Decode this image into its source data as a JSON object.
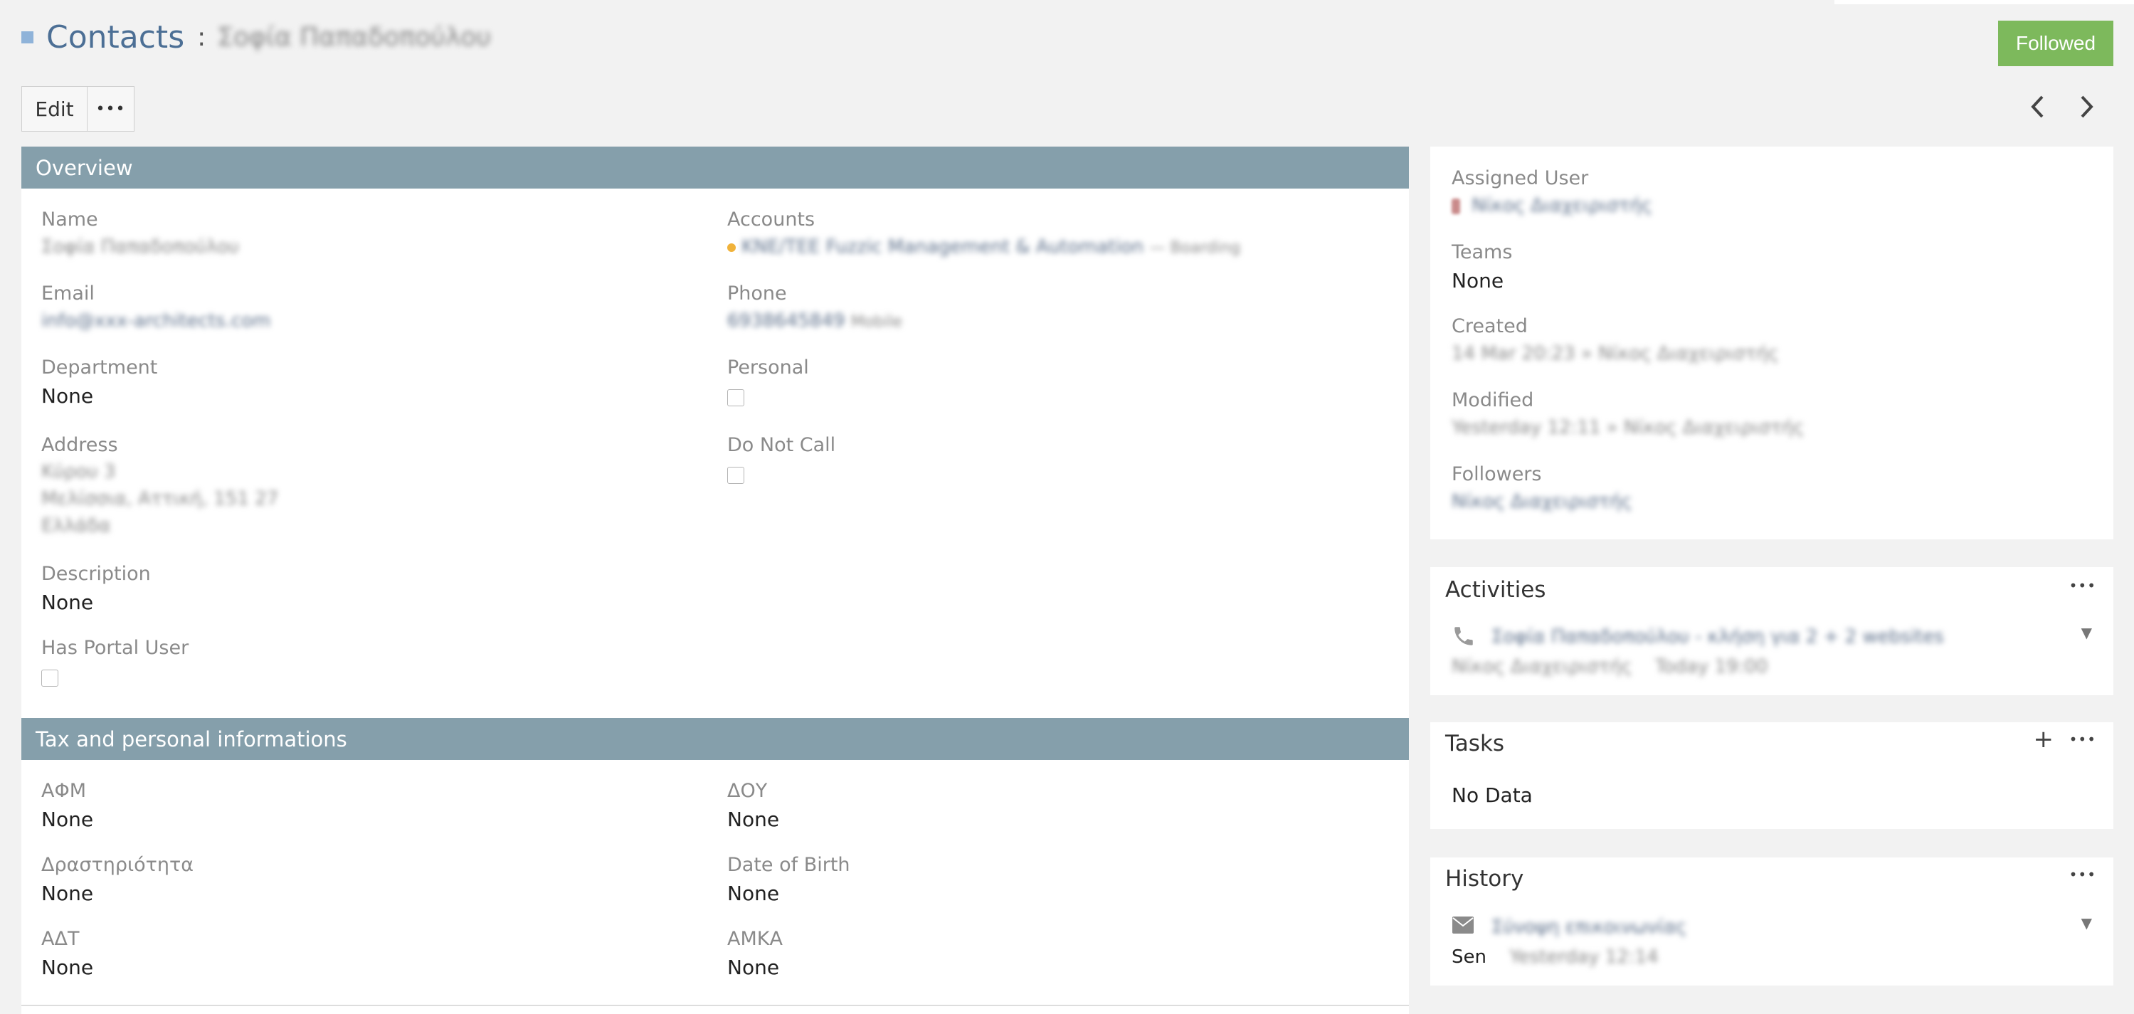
{
  "header": {
    "module": "Contacts",
    "separator": ":",
    "record_name": "Σοφία Παπαδοπούλου"
  },
  "actions": {
    "edit": "Edit",
    "more": "•••",
    "followed": "Followed"
  },
  "icons": {
    "prev": "chevron-left",
    "next": "chevron-right",
    "phone": "phone",
    "envelope": "envelope",
    "user": "user"
  },
  "overview": {
    "title": "Overview",
    "name_label": "Name",
    "name_value": "Σοφία Παπαδοπούλου",
    "accounts_label": "Accounts",
    "accounts_value": "ΚΝΕ/ΤΕΕ Fuzzic Management & Automation",
    "accounts_role": "— Boarding",
    "email_label": "Email",
    "email_value": "info@xxx-architects.com",
    "phone_label": "Phone",
    "phone_value": "6938645849",
    "phone_type": "Mobile",
    "department_label": "Department",
    "department_value": "None",
    "personal_label": "Personal",
    "address_label": "Address",
    "address_line1": "Κύρου 3",
    "address_line2": "Μελίσσια, Αττική, 151 27",
    "address_line3": "Ελλάδα",
    "donotcall_label": "Do Not Call",
    "description_label": "Description",
    "description_value": "None",
    "portal_label": "Has Portal User"
  },
  "tax": {
    "title": "Tax and personal informations",
    "afm_label": "ΑΦΜ",
    "afm_value": "None",
    "doy_label": "ΔΟΥ",
    "doy_value": "None",
    "activity_label": "Δραστηριότητα",
    "activity_value": "None",
    "dob_label": "Date of Birth",
    "dob_value": "None",
    "adt_label": "ΑΔΤ",
    "adt_value": "None",
    "amka_label": "ΑΜΚΑ",
    "amka_value": "None"
  },
  "side": {
    "assigned_label": "Assigned User",
    "assigned_value": "Νίκος Διαχειριστής",
    "teams_label": "Teams",
    "teams_value": "None",
    "created_label": "Created",
    "created_value": "14 Mar 20:23 » Νίκος Διαχειριστής",
    "modified_label": "Modified",
    "modified_value": "Yesterday 12:11 » Νίκος Διαχειριστής",
    "followers_label": "Followers",
    "followers_value": "Νίκος Διαχειριστής"
  },
  "activities": {
    "title": "Activities",
    "item_title": "Σοφία Παπαδοπούλου - κλήση για 2 + 2 websites",
    "item_user": "Νίκος Διαχειριστής",
    "item_time": "Today 19:00"
  },
  "tasks": {
    "title": "Tasks",
    "add": "+",
    "empty": "No Data"
  },
  "history": {
    "title": "History",
    "item_title": "Σύνοψη επικοινωνίας",
    "item_prefix": "Sen",
    "item_time": "Yesterday 12:14"
  }
}
